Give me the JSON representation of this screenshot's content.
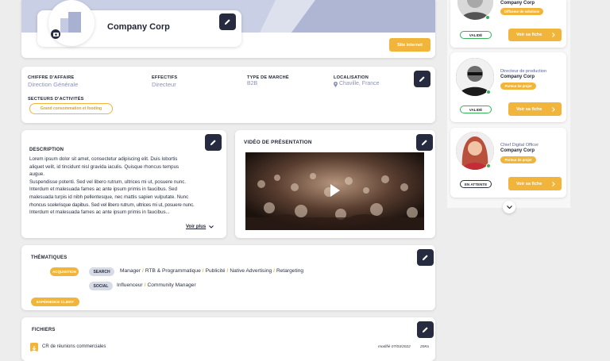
{
  "company": {
    "name": "Company Corp",
    "website_button": "Site internet"
  },
  "info": {
    "fields": [
      {
        "label": "CHIFFRE D'AFFAIRE",
        "value": "Direction Générale"
      },
      {
        "label": "EFFECTIFS",
        "value": "Directeur"
      },
      {
        "label": "TYPE DE MARCHÉ",
        "value": "B2B"
      },
      {
        "label": "LOCALISATION",
        "value": "Chaville, France"
      }
    ],
    "sectors_label": "SECTEURS D'ACTIVITÉS",
    "sector_tag": "Grand consommation et fooding"
  },
  "description": {
    "title": "DESCRIPTION",
    "text": "Lorem ipsum dolor sit amet, consectetur adipiscing elit. Duis lobortis aliquet velit, id tincidunt nisl gravida iaculis. Quisque rhoncus tempus augue. Suspendisse potenti. Sed vel libero rutrum, ultrices mi ut, posuere nunc. Interdum et malesuada fames ac ante ipsum primis in faucibus. Sed malesuada turpis id nibh pellentesque, nec mattis sapien vulputate. Nunc rhoncus scelerisque dapibus. Sed vel libero rutrum, ultrices mi ut, posuere nunc. Interdum et malesuada fames ac ante ipsum primis in faucibus...",
    "lines": [
      "Lorem ipsum dolor sit amet, consectetur adipiscing elit. Duis lobortis",
      "aliquet velit, id tincidunt nisl gravida iaculis. Quisque rhoncus tempus",
      "augue.",
      "Suspendisse potenti. Sed vel libero rutrum, ultrices mi ut, posuere nunc.",
      "Interdum et malesuada fames ac ante ipsum primis in faucibus. Sed",
      "malesuada turpis id nibh pellentesque, nec mattis sapien vulputate. Nunc",
      "rhoncus scelerisque dapibus. Sed vel libero rutrum, ultrices mi ut, posuere nunc.",
      "Interdum et malesuada fames ac ante ipsum primis in faucibus..."
    ],
    "see_more": "Voir plus"
  },
  "video": {
    "title": "VIDÉO DE PRÉSENTATION"
  },
  "themes": {
    "title": "THÉMATIQUES",
    "acquisition_tag": "ACQUISITION",
    "search_tag": "SEARCH",
    "search_items": [
      "Manager",
      "RTB & Programmatique",
      "Publicité",
      "Native Advertising",
      "Retargeting"
    ],
    "social_tag": "SOCIAL",
    "social_items": [
      "Influenceur",
      "Community Manager"
    ],
    "experience_tag": "EXPÉRIENCE CLIENT"
  },
  "files": {
    "title": "FICHIERS",
    "items": [
      {
        "name": "CR de réunions commerciales",
        "modified": "modifié 07/03/2022",
        "size": "20Ko"
      }
    ]
  },
  "contacts": [
    {
      "role": "",
      "company": "Company Corp",
      "badge": "Diffuseur de solutions",
      "status": "VALIDÉ",
      "button": "Voir sa fiche"
    },
    {
      "role": "Directeur de production",
      "company": "Company Corp",
      "badge": "Porteur de projet",
      "status": "VALIDÉ",
      "button": "Voir sa fiche"
    },
    {
      "role": "Chief Digital Officer",
      "company": "Company Corp",
      "badge": "Porteur de projet",
      "status": "EN ATTENTE",
      "button": "Voir sa fiche"
    }
  ],
  "colors": {
    "accent": "#f2b53c",
    "dark": "#262b3f",
    "muted": "#8a93b8",
    "success": "#3ab05a"
  }
}
